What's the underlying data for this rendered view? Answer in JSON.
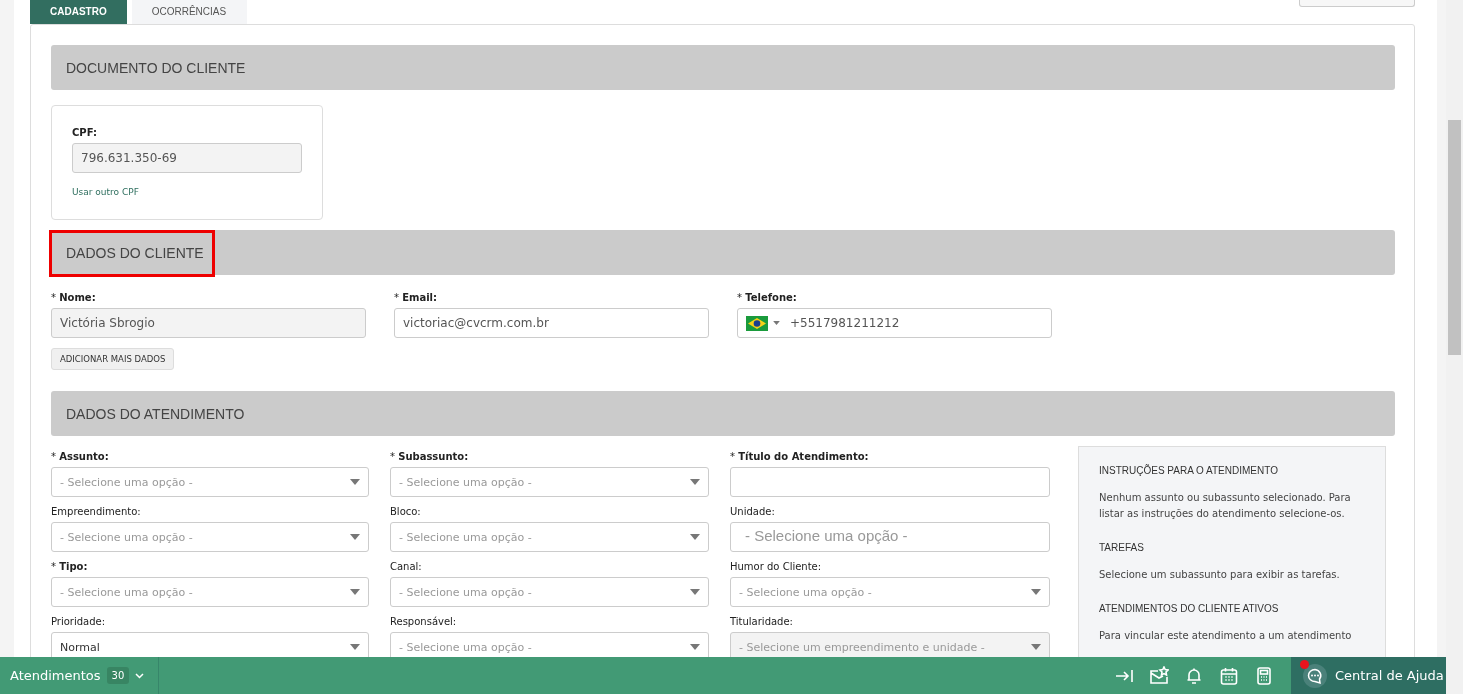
{
  "tabs": [
    {
      "label": "CADASTRO",
      "selected": true
    },
    {
      "label": "OCORRÊNCIAS",
      "selected": false
    }
  ],
  "document_section": {
    "title": "DOCUMENTO DO CLIENTE",
    "cpf": {
      "label": "CPF:",
      "value": "796.631.350-69",
      "disabled": true
    },
    "link": "Usar outro CPF"
  },
  "client_section": {
    "title": "DADOS DO CLIENTE",
    "highlighted": true,
    "fields": [
      {
        "label": "* **Nome:**",
        "kind": "text",
        "value": "Victória Sbrogio",
        "disabled": true
      },
      {
        "label": "* **Email:**",
        "kind": "text",
        "value": "victoriac@cvcrm.com.br",
        "disabled": false
      },
      {
        "label": "* **Telefone:**",
        "kind": "phone",
        "value": "+5517981211212",
        "disabled": false
      }
    ],
    "add_button": "ADICIONAR MAIS DADOS"
  },
  "service_section": {
    "title": "DADOS DO ATENDIMENTO",
    "fields": [
      {
        "label": "* **Assunto:**",
        "kind": "select",
        "placeholder": "- Selecione uma opção -",
        "disabled": false
      },
      {
        "label": "* **Subassunto:**",
        "kind": "select",
        "placeholder": "- Selecione uma opção -",
        "disabled": false
      },
      {
        "label": "* **Título do Atendimento:**",
        "kind": "input",
        "disabled": false
      },
      {
        "label": "Empreendimento:",
        "kind": "select",
        "placeholder": "- Selecione uma opção -",
        "disabled": false
      },
      {
        "label": "Bloco:",
        "kind": "select",
        "placeholder": "- Selecione uma opção -",
        "disabled": false
      },
      {
        "label": "Unidade:",
        "kind": "input",
        "placeholder": "- Selecione uma opção -",
        "disabled": false
      },
      {
        "label": "* **Tipo:**",
        "kind": "select",
        "placeholder": "- Selecione uma opção -",
        "disabled": false
      },
      {
        "label": "Canal:",
        "kind": "select",
        "placeholder": "- Selecione uma opção -",
        "disabled": false
      },
      {
        "label": "Humor do Cliente:",
        "kind": "select",
        "placeholder": "- Selecione uma opção -",
        "disabled": false
      },
      {
        "label": "Prioridade:",
        "kind": "select",
        "value": "Normal",
        "disabled": false
      },
      {
        "label": "Responsável:",
        "kind": "select",
        "placeholder": "- Selecione uma opção -",
        "disabled": false
      },
      {
        "label": "Titularidade:",
        "kind": "select",
        "placeholder": "- Selecione um empreendimento e unidade -",
        "disabled": true
      }
    ],
    "instructions": [
      {
        "heading": "INSTRUÇÕES PARA O ATENDIMENTO",
        "text": "Nenhum assunto ou subassunto selecionado. Para listar as instruções do atendimento selecione-os."
      },
      {
        "heading": "TAREFAS",
        "text": "Selecione um subassunto para exibir as tarefas."
      },
      {
        "heading": "ATENDIMENTOS DO CLIENTE ATIVOS",
        "text": "Para vincular este atendimento a um atendimento"
      }
    ]
  },
  "bottom_bar": {
    "label": "Atendimentos",
    "count": "30",
    "help_label": "Central de Ajuda",
    "help_notification": true
  }
}
